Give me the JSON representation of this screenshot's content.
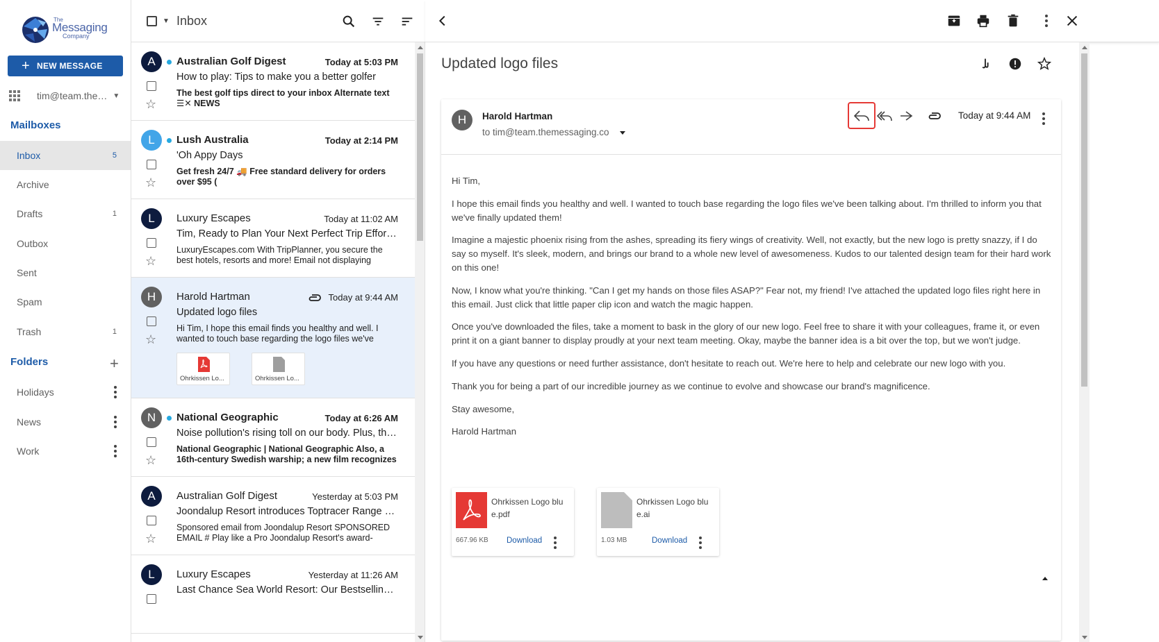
{
  "logo": {
    "line1": "The",
    "line2": "Messaging",
    "line3": "Company"
  },
  "sidebar": {
    "new_message_label": "NEW MESSAGE",
    "account": "tim@team.the…",
    "mailboxes_title": "Mailboxes",
    "mailboxes": [
      {
        "label": "Inbox",
        "count": "5"
      },
      {
        "label": "Archive",
        "count": ""
      },
      {
        "label": "Drafts",
        "count": "1"
      },
      {
        "label": "Outbox",
        "count": ""
      },
      {
        "label": "Sent",
        "count": ""
      },
      {
        "label": "Spam",
        "count": ""
      },
      {
        "label": "Trash",
        "count": "1"
      }
    ],
    "folders_title": "Folders",
    "folders": [
      {
        "label": "Holidays"
      },
      {
        "label": "News"
      },
      {
        "label": "Work"
      }
    ]
  },
  "list_header": {
    "title": "Inbox"
  },
  "messages": [
    {
      "initial": "A",
      "avatar_color": "#0d1b3e",
      "unread": true,
      "sender": "Australian Golf Digest",
      "time": "Today at 5:03 PM",
      "subject": "How to play: Tips to make you a better golfer",
      "preview": "The best golf tips direct to your inbox Alternate text ☰✕ NEWS"
    },
    {
      "initial": "L",
      "avatar_color": "#42a5e8",
      "unread": true,
      "sender": "Lush Australia",
      "time": "Today at 2:14 PM",
      "subject": "'Oh Appy Days",
      "preview": "Get fresh 24/7 🚚 Free standard delivery for orders over $95 ("
    },
    {
      "initial": "L",
      "avatar_color": "#0d1b3e",
      "unread": false,
      "sender": "Luxury Escapes",
      "time": "Today at 11:02 AM",
      "subject": "Tim, Ready to Plan Your Next Perfect Trip Effortlessly?",
      "preview": "LuxuryEscapes.com With TripPlanner, you secure the best hotels, resorts and more!   Email not displaying"
    },
    {
      "initial": "H",
      "avatar_color": "#616161",
      "unread": false,
      "sender": "Harold Hartman",
      "time": "Today at 9:44 AM",
      "subject": "Updated logo files",
      "preview": "Hi Tim, I hope this email finds you healthy and well. I wanted to touch base regarding the logo files we've",
      "attachments": [
        "Ohrkissen Lo...",
        "Ohrkissen Lo..."
      ]
    },
    {
      "initial": "N",
      "avatar_color": "#616161",
      "unread": true,
      "sender": "National Geographic",
      "time": "Today at 6:26 AM",
      "subject": "Noise pollution's rising toll on our body. Plus, the 'golden age' of",
      "preview": "National Geographic | National Geographic Also, a 16th-century Swedish warship; a new film recognizes"
    },
    {
      "initial": "A",
      "avatar_color": "#0d1b3e",
      "unread": false,
      "sender": "Australian Golf Digest",
      "time": "Yesterday at 5:03 PM",
      "subject": "Joondalup Resort introduces Toptracer Range technology",
      "preview": "Sponsored email from Joondalup Resort SPONSORED EMAIL # Play like a Pro Joondalup Resort's award-"
    },
    {
      "initial": "L",
      "avatar_color": "#0d1b3e",
      "unread": false,
      "sender": "Luxury Escapes",
      "time": "Yesterday at 11:26 AM",
      "subject": "Last Chance Sea World Resort: Our Bestselling Gold Coast Deal",
      "preview": ""
    }
  ],
  "reader": {
    "title": "Updated logo files",
    "from_initial": "H",
    "from_name": "Harold Hartman",
    "to": "to tim@team.themessaging.co",
    "time": "Today at 9:44 AM",
    "body": [
      "Hi Tim,",
      "I hope this email finds you healthy and well. I wanted to touch base regarding the logo files we've been talking about. I'm thrilled to inform you that we've finally updated them!",
      "Imagine a majestic phoenix rising from the ashes, spreading its fiery wings of creativity. Well, not exactly, but the new logo is pretty snazzy, if I do say so myself. It's sleek, modern, and brings our brand to a whole new level of awesomeness. Kudos to our talented design team for their hard work on this one!",
      "Now, I know what you're thinking. \"Can I get my hands on those files ASAP?\" Fear not, my friend! I've attached the updated logo files right here in this email. Just click that little paper clip icon and watch the magic happen.",
      "Once you've downloaded the files, take a moment to bask in the glory of our new logo. Feel free to share it with your colleagues, frame it, or even print it on a giant banner to display proudly at your next team meeting. Okay, maybe the banner idea is a bit over the top, but we won't judge.",
      "If you have any questions or need further assistance, don't hesitate to reach out. We're here to help and celebrate our new logo with you.",
      "Thank you for being a part of our incredible journey as we continue to evolve and showcase our brand's magnificence.",
      "Stay awesome,",
      "Harold Hartman"
    ],
    "attachments": [
      {
        "name": "Ohrkissen Logo blue.pdf",
        "size": "667.96 KB",
        "action": "Download",
        "type": "pdf-icon"
      },
      {
        "name": "Ohrkissen Logo blue.ai",
        "size": "1.03 MB",
        "action": "Download",
        "type": "file-icon"
      }
    ]
  },
  "colors": {
    "accent": "#1d5ba8",
    "unread_dot": "#26a9e0",
    "highlight": "#e53935",
    "selected_row": "#e8f0fb"
  }
}
